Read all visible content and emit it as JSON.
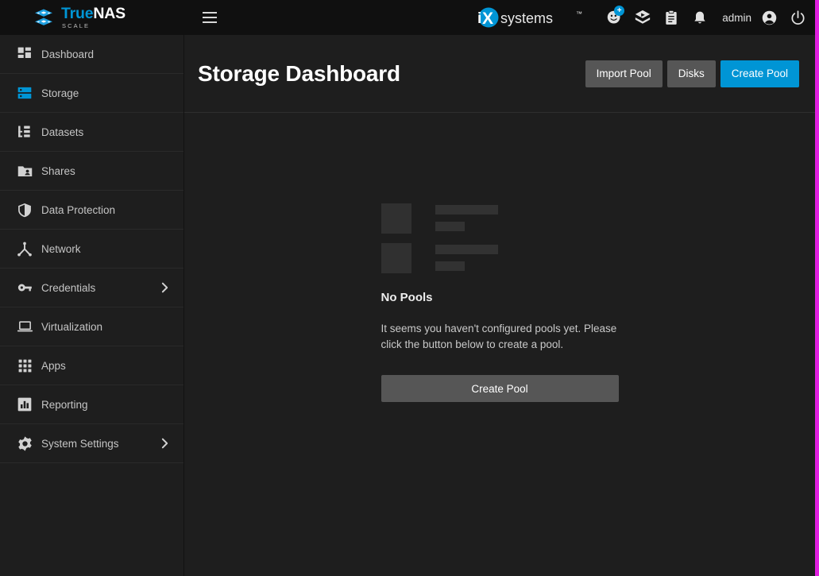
{
  "brand": {
    "name_part1": "True",
    "name_part2": "NAS",
    "subtitle": "SCALE",
    "logo_icon": "truenas-cubes-logo",
    "vendor_logo": "ixsystems-logo"
  },
  "topbar": {
    "menu_icon": "hamburger-menu-icon",
    "icons": [
      {
        "name": "add-user-icon",
        "badge": "+"
      },
      {
        "name": "layers-cube-icon",
        "badge": ""
      },
      {
        "name": "clipboard-tasks-icon",
        "badge": ""
      },
      {
        "name": "notification-bell-icon",
        "badge": ""
      }
    ],
    "username": "admin",
    "avatar_icon": "user-account-icon",
    "power_icon": "power-button-icon"
  },
  "sidebar": {
    "items": [
      {
        "label": "Dashboard",
        "icon": "dashboard-grid-icon",
        "active": false,
        "expandable": false
      },
      {
        "label": "Storage",
        "icon": "storage-server-icon",
        "active": true,
        "expandable": false
      },
      {
        "label": "Datasets",
        "icon": "datasets-tree-icon",
        "active": false,
        "expandable": false
      },
      {
        "label": "Shares",
        "icon": "shares-folder-user-icon",
        "active": false,
        "expandable": false
      },
      {
        "label": "Data Protection",
        "icon": "shield-icon",
        "active": false,
        "expandable": false
      },
      {
        "label": "Network",
        "icon": "network-nodes-icon",
        "active": false,
        "expandable": false
      },
      {
        "label": "Credentials",
        "icon": "key-icon",
        "active": false,
        "expandable": true
      },
      {
        "label": "Virtualization",
        "icon": "laptop-icon",
        "active": false,
        "expandable": false
      },
      {
        "label": "Apps",
        "icon": "apps-grid-icon",
        "active": false,
        "expandable": false
      },
      {
        "label": "Reporting",
        "icon": "bar-chart-icon",
        "active": false,
        "expandable": false
      },
      {
        "label": "System Settings",
        "icon": "gear-icon",
        "active": false,
        "expandable": true
      }
    ],
    "chevron_icon": "chevron-right-icon"
  },
  "page": {
    "title": "Storage Dashboard",
    "actions": [
      {
        "label": "Import Pool",
        "style": "gray"
      },
      {
        "label": "Disks",
        "style": "gray"
      },
      {
        "label": "Create Pool",
        "style": "blue"
      }
    ]
  },
  "empty_state": {
    "title": "No Pools",
    "description": "It seems you haven't configured pools yet. Please click the button below to create a pool.",
    "button_label": "Create Pool",
    "skeleton_rows": 2
  },
  "colors": {
    "accent_blue": "#0095d5",
    "button_gray": "#565656",
    "topbar_bg": "#101010",
    "body_bg": "#1e1e1e",
    "edge_strip": "#e020e0"
  }
}
